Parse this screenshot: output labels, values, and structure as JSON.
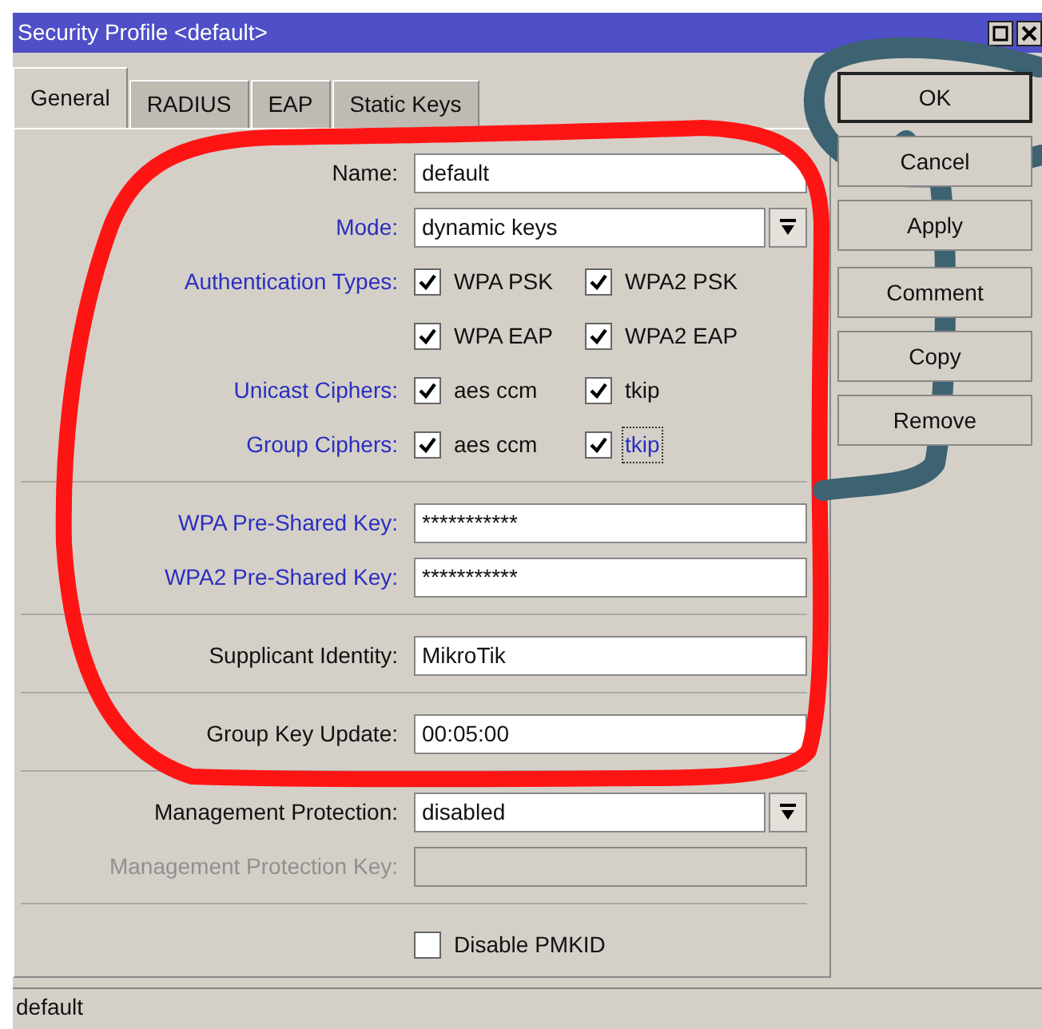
{
  "window": {
    "title": "Security Profile <default>"
  },
  "tabs": [
    {
      "label": "General",
      "selected": true
    },
    {
      "label": "RADIUS",
      "selected": false
    },
    {
      "label": "EAP",
      "selected": false
    },
    {
      "label": "Static Keys",
      "selected": false
    }
  ],
  "form_groups": [
    [
      {
        "kind": "text",
        "label": "Name:",
        "accent": false,
        "disabled": false,
        "value": "default"
      },
      {
        "kind": "select",
        "label": "Mode:",
        "accent": true,
        "disabled": false,
        "value": "dynamic keys"
      },
      {
        "kind": "checks",
        "label": "Authentication Types:",
        "accent": true,
        "items": [
          {
            "label": "WPA PSK",
            "checked": true,
            "focused": false
          },
          {
            "label": "WPA2 PSK",
            "checked": true,
            "focused": false
          }
        ]
      },
      {
        "kind": "checks",
        "items": [
          {
            "label": "WPA EAP",
            "checked": true,
            "focused": false
          },
          {
            "label": "WPA2 EAP",
            "checked": true,
            "focused": false
          }
        ]
      },
      {
        "kind": "checks",
        "label": "Unicast Ciphers:",
        "accent": true,
        "items": [
          {
            "label": "aes ccm",
            "checked": true,
            "focused": false
          },
          {
            "label": "tkip",
            "checked": true,
            "focused": false
          }
        ]
      },
      {
        "kind": "checks",
        "label": "Group Ciphers:",
        "accent": true,
        "items": [
          {
            "label": "aes ccm",
            "checked": true,
            "focused": false
          },
          {
            "label": "tkip",
            "checked": true,
            "focused": true
          }
        ]
      }
    ],
    [
      {
        "kind": "text",
        "label": "WPA Pre-Shared Key:",
        "accent": true,
        "disabled": false,
        "value": "***********"
      },
      {
        "kind": "text",
        "label": "WPA2 Pre-Shared Key:",
        "accent": true,
        "disabled": false,
        "value": "***********"
      }
    ],
    [
      {
        "kind": "text",
        "label": "Supplicant Identity:",
        "accent": false,
        "disabled": false,
        "value": "MikroTik"
      }
    ],
    [
      {
        "kind": "text",
        "label": "Group Key Update:",
        "accent": false,
        "disabled": false,
        "value": "00:05:00"
      }
    ],
    [
      {
        "kind": "select",
        "label": "Management Protection:",
        "accent": false,
        "disabled": false,
        "value": "disabled"
      },
      {
        "kind": "text",
        "label": "Management Protection Key:",
        "accent": false,
        "disabled": true
      }
    ],
    [
      {
        "kind": "checks",
        "items": [
          {
            "label": "Disable PMKID",
            "checked": false,
            "focused": false
          }
        ]
      }
    ]
  ],
  "button_groups": [
    [
      {
        "label": "OK",
        "default": true
      },
      {
        "label": "Cancel",
        "default": false
      },
      {
        "label": "Apply",
        "default": false
      }
    ],
    [
      {
        "label": "Comment",
        "default": false
      },
      {
        "label": "Copy",
        "default": false
      },
      {
        "label": "Remove",
        "default": false
      }
    ]
  ],
  "status_bar": "default"
}
